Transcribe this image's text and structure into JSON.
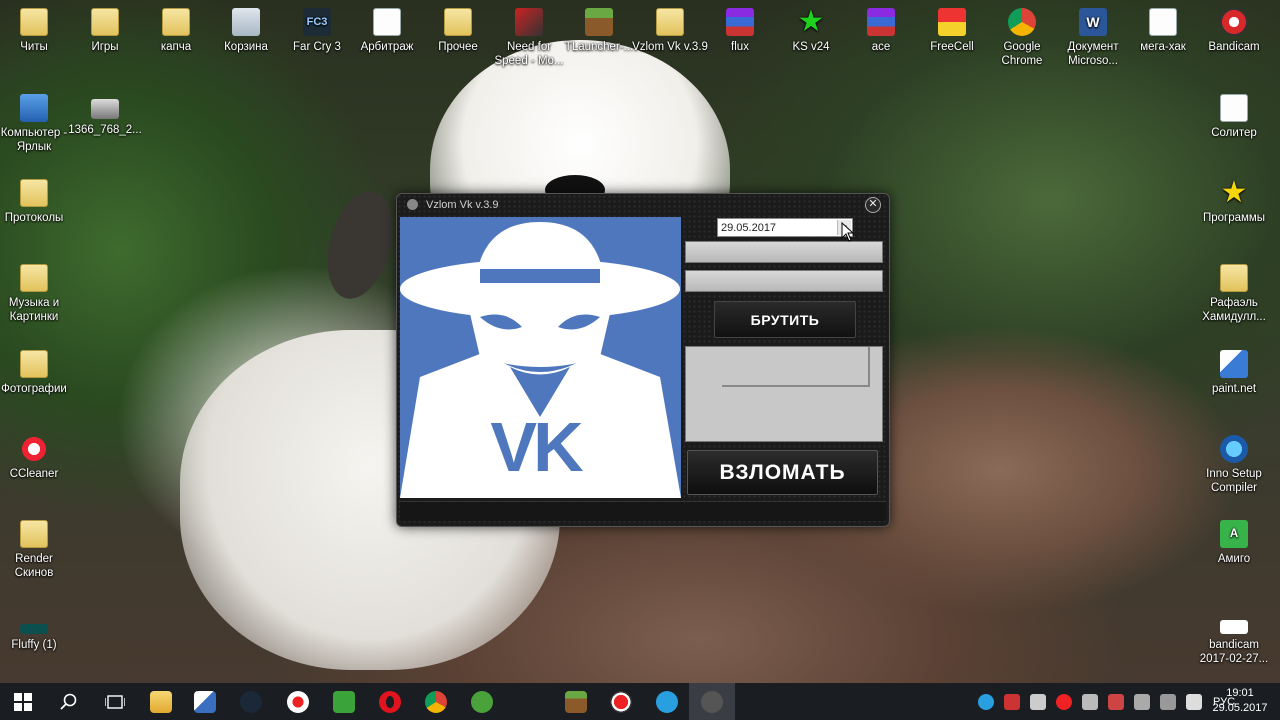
{
  "desktop": {
    "icons": [
      {
        "label": "Читы"
      },
      {
        "label": "Игры"
      },
      {
        "label": "капча"
      },
      {
        "label": "Корзина"
      },
      {
        "label": "Far Cry 3"
      },
      {
        "label": "Арбитраж"
      },
      {
        "label": "Прочее"
      },
      {
        "label": "Need for Speed - Mo..."
      },
      {
        "label": "TLauncher-..."
      },
      {
        "label": "Vzlom Vk v.3.9"
      },
      {
        "label": "flux"
      },
      {
        "label": "KS v24"
      },
      {
        "label": "ace"
      },
      {
        "label": "FreeCell"
      },
      {
        "label": "Google Chrome"
      },
      {
        "label": "Документ Microso..."
      },
      {
        "label": "мега-хак"
      },
      {
        "label": "Bandicam"
      },
      {
        "label": "Компьютер - Ярлык"
      },
      {
        "label": "1366_768_2..."
      },
      {
        "label": "Протоколы"
      },
      {
        "label": "Музыка и Картинки"
      },
      {
        "label": "Фотографии"
      },
      {
        "label": "CCleaner"
      },
      {
        "label": "Render Скинов"
      },
      {
        "label": "Fluffy (1)"
      },
      {
        "label": "Солитер"
      },
      {
        "label": "Программы"
      },
      {
        "label": "Рафаэль Хамидулл..."
      },
      {
        "label": "paint.net"
      },
      {
        "label": "Inno Setup Compiler"
      },
      {
        "label": "Амиго"
      },
      {
        "label": "bandicam 2017-02-27..."
      }
    ],
    "fc3_glyph": "FC3",
    "word_glyph": "W",
    "amigo_glyph": "A"
  },
  "window": {
    "title": "Vzlom Vk v.3.9",
    "close_glyph": "✕",
    "date_value": "29.05.2017",
    "dropdown_glyph": "▼",
    "brute_label": "БРУТИТЬ",
    "hack_label": "ВЗЛОМАТЬ",
    "logo_text": "VK"
  },
  "taskbar": {
    "lang": "РУС",
    "time": "19:01",
    "date": "29.05.2017"
  },
  "colors": {
    "logo_bg": "#4e77be",
    "taskbar_bg": "#1a1d22"
  }
}
